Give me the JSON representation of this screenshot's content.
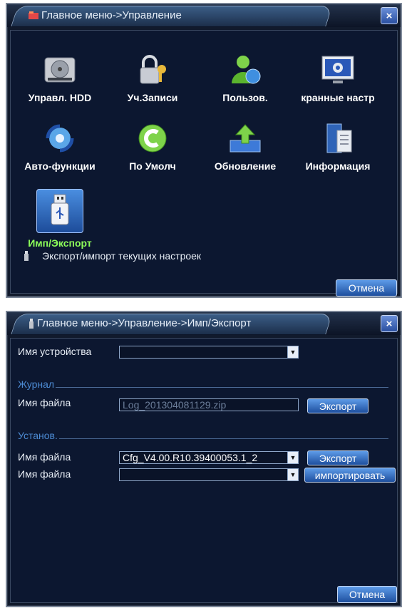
{
  "win1": {
    "title": "Главное меню->Управление",
    "close": "×",
    "tiles": [
      {
        "label": "Управл. HDD",
        "icon": "hdd-icon"
      },
      {
        "label": "Уч.Записи",
        "icon": "lock-key-icon"
      },
      {
        "label": "Пользов.",
        "icon": "user-icon"
      },
      {
        "label": "кранные настр",
        "icon": "display-settings-icon"
      },
      {
        "label": "Авто-функции",
        "icon": "auto-function-icon"
      },
      {
        "label": "По Умолч",
        "icon": "default-reset-icon"
      },
      {
        "label": "Обновление",
        "icon": "upgrade-icon"
      },
      {
        "label": "Информация",
        "icon": "info-icon"
      },
      {
        "label": "Имп/Экспорт",
        "icon": "usb-icon",
        "selected": true
      }
    ],
    "description": "Экспорт/импорт текущих настроек",
    "cancel": "Отмена"
  },
  "win2": {
    "title": "Главное меню->Управление->Имп/Экспорт",
    "close": "×",
    "device_label": "Имя устройства",
    "device_value": "",
    "log_section": "Журнал",
    "log_file_label": "Имя файла",
    "log_file_value": "Log_201304081129.zip",
    "log_export": "Экспорт",
    "settings_section": "Установ.",
    "cfg_file_label": "Имя файла",
    "cfg_file_value": "Cfg_V4.00.R10.39400053.1_2",
    "cfg_export": "Экспорт",
    "import_file_label": "Имя файла",
    "import_file_value": "",
    "import_button": "импортировать",
    "cancel": "Отмена"
  },
  "colors": {
    "window_bg": "#0c1730",
    "accent_green": "#8dff5a",
    "section_blue": "#4c8ad2",
    "button_blue": "#2f6cc0"
  }
}
